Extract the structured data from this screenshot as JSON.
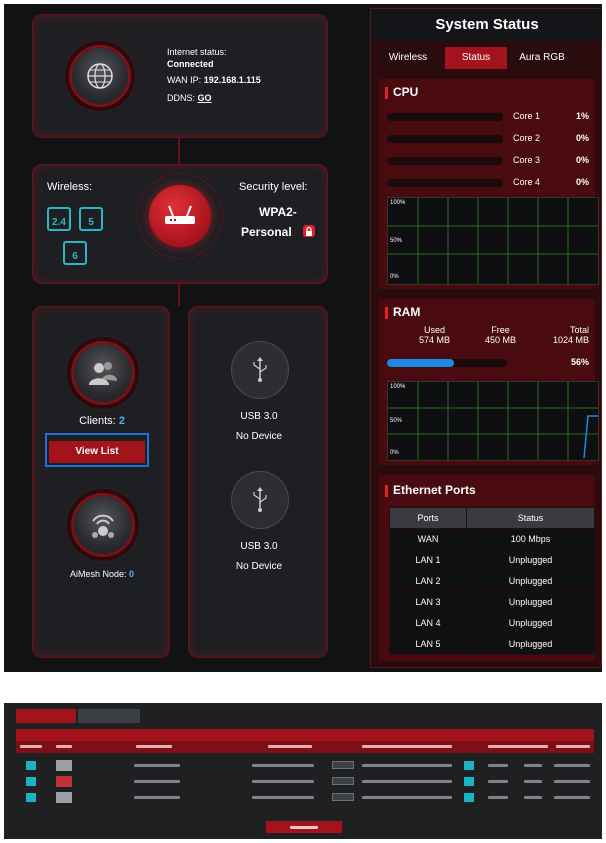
{
  "internet": {
    "status_label": "Internet status:",
    "status_value": "Connected",
    "wan_label": "WAN IP:",
    "wan_ip": "192.168.1.115",
    "ddns_label": "DDNS:",
    "ddns_link": "GO"
  },
  "wireless": {
    "label": "Wireless:",
    "bands": [
      "2.4",
      "5",
      "6"
    ],
    "security_label": "Security level:",
    "security_value_1": "WPA2-",
    "security_value_2": "Personal"
  },
  "clients": {
    "label": "Clients:",
    "count": "2",
    "view_list": "View List",
    "aimesh_label": "AiMesh Node:",
    "aimesh_count": "0"
  },
  "usb": [
    {
      "label": "USB 3.0",
      "status": "No Device"
    },
    {
      "label": "USB 3.0",
      "status": "No Device"
    }
  ],
  "system_status": {
    "title": "System Status",
    "tabs": [
      "Wireless",
      "Status",
      "Aura RGB"
    ],
    "active_tab": "Status",
    "cpu": {
      "title": "CPU",
      "cores": [
        {
          "name": "Core 1",
          "value": "1%"
        },
        {
          "name": "Core 2",
          "value": "0%"
        },
        {
          "name": "Core 3",
          "value": "0%"
        },
        {
          "name": "Core 4",
          "value": "0%"
        }
      ],
      "graph_labels": [
        "100%",
        "50%",
        "0%"
      ]
    },
    "ram": {
      "title": "RAM",
      "used_label": "Used",
      "used_value": "574 MB",
      "free_label": "Free",
      "free_value": "450 MB",
      "total_label": "Total",
      "total_value": "1024 MB",
      "percent": "56%",
      "usage_fraction": 0.56,
      "graph_labels": [
        "100%",
        "50%",
        "0%"
      ]
    },
    "ethernet": {
      "title": "Ethernet Ports",
      "headers": [
        "Ports",
        "Status"
      ],
      "rows": [
        [
          "WAN",
          "100 Mbps"
        ],
        [
          "LAN 1",
          "Unplugged"
        ],
        [
          "LAN 2",
          "Unplugged"
        ],
        [
          "LAN 3",
          "Unplugged"
        ],
        [
          "LAN 4",
          "Unplugged"
        ],
        [
          "LAN 5",
          "Unplugged"
        ]
      ]
    }
  },
  "colors": {
    "accent_red": "#a3131b",
    "teal": "#28b7c8",
    "ram_bar": "#1e88e5",
    "graph_line": "#2f6b2a"
  }
}
